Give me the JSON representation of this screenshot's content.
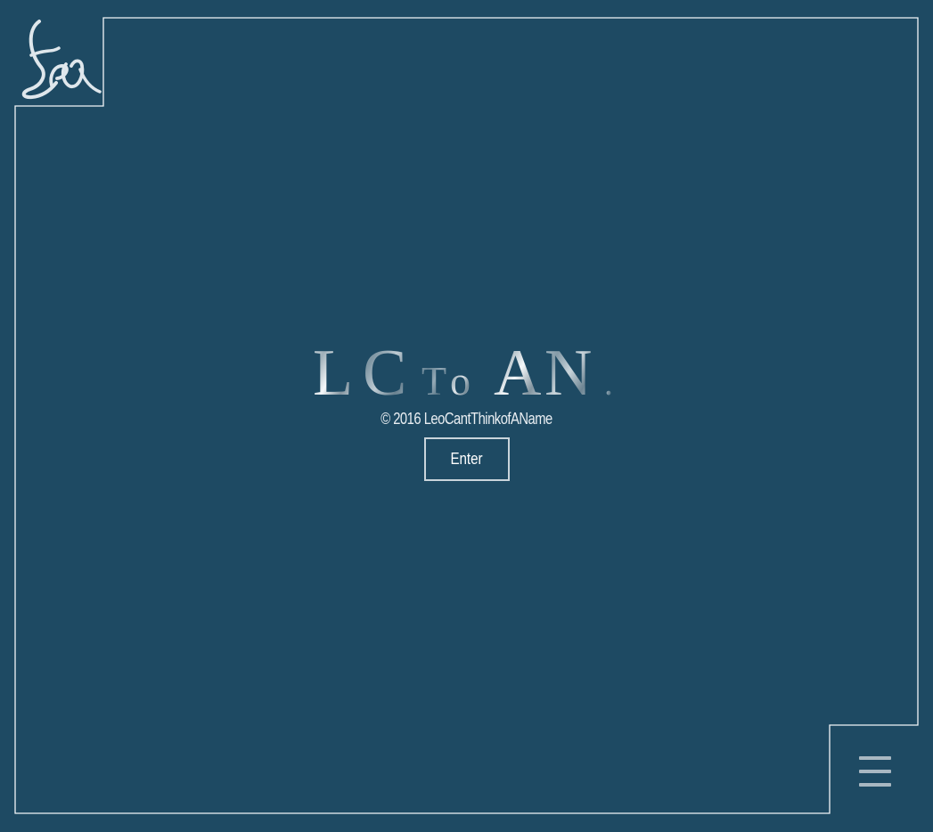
{
  "brand": {
    "logo_text": "Leo",
    "wordmark": "LCToAN"
  },
  "footer": {
    "copyright": "© 2016 LeoCantThinkofAName"
  },
  "actions": {
    "enter_label": "Enter"
  },
  "menu": {
    "icon": "hamburger-menu-icon"
  },
  "colors": {
    "background": "#1e4a63",
    "border": "#f2f5f7",
    "text": "#ffffff",
    "menu_icon": "#a9b8c2"
  }
}
